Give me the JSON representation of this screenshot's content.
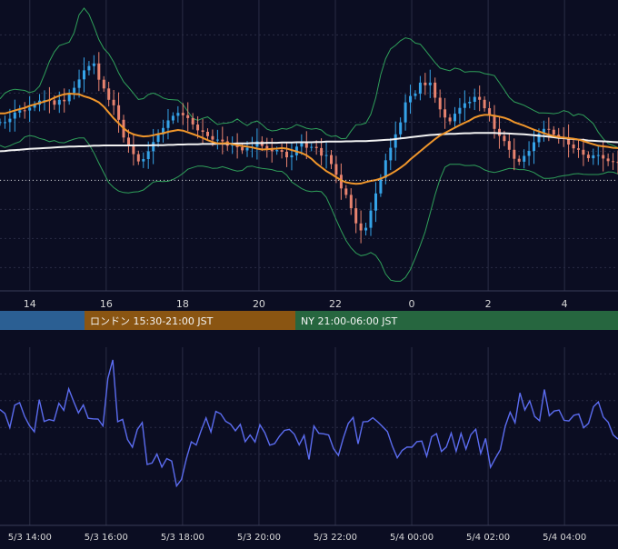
{
  "colors": {
    "background": "#0b0d22",
    "grid": "#2a2d45",
    "up": "#35a3e8",
    "down": "#e8836f",
    "bollinger": "#2fa05a",
    "ma_short": "#f0962b",
    "ma_long": "#f2f2f2",
    "oscillator": "#5b6cf0",
    "axis_text": "#d8d8d8",
    "session_tokyo": "#2b5f93",
    "session_london": "#8a5512",
    "session_ny": "#26663f"
  },
  "sessions": [
    {
      "label": "",
      "color": "#2b5f93"
    },
    {
      "label": "ロンドン 15:30-21:00 JST",
      "color": "#8a5512"
    },
    {
      "label": "NY 21:00-06:00 JST",
      "color": "#26663f"
    }
  ],
  "chart_data": [
    {
      "type": "candlestick",
      "x_tick_labels": [
        "14",
        "16",
        "18",
        "20",
        "22",
        "0",
        "2",
        "4"
      ],
      "x_ticks_hours": [
        14,
        16,
        18,
        20,
        22,
        24,
        26,
        28
      ],
      "x_range_hours": [
        13.22,
        29.4
      ],
      "y_range": [
        0,
        100
      ],
      "y_grid": [
        8,
        18,
        28,
        38,
        48,
        58,
        68,
        78,
        88
      ],
      "reference_level": 38,
      "series": [
        {
          "role": "price_close",
          "values": [
            58,
            58.0,
            59.2,
            61.3,
            62.1,
            62.0,
            63.0,
            64.0,
            65.4,
            65.6,
            65.5,
            64.0,
            65.7,
            65.2,
            68.1,
            69.8,
            72.7,
            75.8,
            77.3,
            78.2,
            72.6,
            69.6,
            65.7,
            63.8,
            58.8,
            52.7,
            50.3,
            47.0,
            44.5,
            45.3,
            48.0,
            51.2,
            53.8,
            56.0,
            58.6,
            60.2,
            61.2,
            60.4,
            59.4,
            57.2,
            55.2,
            54.7,
            53.2,
            52.0,
            52.0,
            51.4,
            49.9,
            50.3,
            49.4,
            48.3,
            49.2,
            49.6,
            51.4,
            49.8,
            48.6,
            48.0,
            48.4,
            47.8,
            45.9,
            46.6,
            49.6,
            51.0,
            49.2,
            49.5,
            49.1,
            46.5,
            46.7,
            43.6,
            39.9,
            35.2,
            33.0,
            28.4,
            23.2,
            20.8,
            21.7,
            27.6,
            33.5,
            38.9,
            44.9,
            49.2,
            53.8,
            57.9,
            64.8,
            67.0,
            67.8,
            71.6,
            70.7,
            71.6,
            66.4,
            62.4,
            59.6,
            58.3,
            60.9,
            62.9,
            64.5,
            65.0,
            66.7,
            65.7,
            62.8,
            60.5,
            55.7,
            53.3,
            51.5,
            48.5,
            45.4,
            44.4,
            46.4,
            48.1,
            51.1,
            54.1,
            55.7,
            55.4,
            53.7,
            52.9,
            52.8,
            50.3,
            49.0,
            48.5,
            46.8,
            45.6,
            46.6,
            46.7,
            45.5,
            44.6,
            44.4,
            44.0
          ]
        },
        {
          "role": "bollinger_upper",
          "values": [
            66,
            68.0,
            68.9,
            69.3,
            69.1,
            68.9,
            68.2,
            68.7,
            70.4,
            74.5,
            78.9,
            82.2,
            84.3,
            84.9,
            85.5,
            88.8,
            94.9,
            97.2,
            95.1,
            90.9,
            86.4,
            83.3,
            81.5,
            78.7,
            74.9,
            71.9,
            70.0,
            67.9,
            65.8,
            66.1,
            67.5,
            68.0,
            67.3,
            66.3,
            65.8,
            65.7,
            65.6,
            64.1,
            61.7,
            59.3,
            58.6,
            59.3,
            59.8,
            58.5,
            57.2,
            57.6,
            57.7,
            58.1,
            59.1,
            57.8,
            56.8,
            57.9,
            58.4,
            57.2,
            55.6,
            55.0,
            55.2,
            55.8,
            55.6,
            56.2,
            57.2,
            56.6,
            55.9,
            55.6,
            55.8,
            55.3,
            53.8,
            53.1,
            53.3,
            52.3,
            52.4,
            54.9,
            57.1,
            57.2,
            57.7,
            60.7,
            66.3,
            74.3,
            79.8,
            83.2,
            84.4,
            86.0,
            87.0,
            86.6,
            85.2,
            84.8,
            82.8,
            80.6,
            78.5,
            76.6,
            76.1,
            75.7,
            76.6,
            76.2,
            75.2,
            75.4,
            75.4,
            75.3,
            74.7,
            74.4,
            74.0,
            71.6,
            69.1,
            66.5,
            65.0,
            64.4,
            63.8,
            62.9,
            62.0,
            61.2,
            61.2,
            61.1,
            60.9,
            61.2,
            62.0,
            61.5,
            60.2,
            60.8,
            60.4,
            59.0,
            57.5,
            54.6,
            52.3,
            50.7,
            50.0,
            49.2,
            48.4
          ]
        },
        {
          "role": "bollinger_lower",
          "values": [
            50,
            49.3,
            49.9,
            50.7,
            51.3,
            52.9,
            53.4,
            53.1,
            52.4,
            52.0,
            51.3,
            51.7,
            51.0,
            50.9,
            51.6,
            52.2,
            52.6,
            52.6,
            50.4,
            47.4,
            43.9,
            40.6,
            37.2,
            35.5,
            34.3,
            33.8,
            33.7,
            34.0,
            34.1,
            34.7,
            36.0,
            37.4,
            37.7,
            37.6,
            37.7,
            38.3,
            39.2,
            40.4,
            41.8,
            42.4,
            42.9,
            42.9,
            42.6,
            42.1,
            42.2,
            42.7,
            42.2,
            41.6,
            41.2,
            41.4,
            42.7,
            42.9,
            42.4,
            42.1,
            41.9,
            41.7,
            41.2,
            41.1,
            39.8,
            37.4,
            36.3,
            35.2,
            34.4,
            34.1,
            34.3,
            34.1,
            32.2,
            28.4,
            24.5,
            20.7,
            17.3,
            14.8,
            13.0,
            12.1,
            12.4,
            13.2,
            12.2,
            9.7,
            5.8,
            3.7,
            3.3,
            3.3,
            4.6,
            7.3,
            11.3,
            15.6,
            20.3,
            26.7,
            33.0,
            38.5,
            42.5,
            43.5,
            43.5,
            43.5,
            43.1,
            43.1,
            43.2,
            42.6,
            41.6,
            41.0,
            40.7,
            41.1,
            41.6,
            42.1,
            42.0,
            41.7,
            41.7,
            41.3,
            40.7,
            39.6,
            38.7,
            38.7,
            38.8,
            39.3,
            39.6,
            39.8,
            40.2,
            40.3,
            40.1,
            40.0,
            40.0,
            40.0,
            40.3,
            40.9,
            40.8,
            40.2,
            40.4
          ]
        },
        {
          "role": "moving_average_short",
          "values": [
            61,
            61.0,
            61.5,
            62.0,
            62.5,
            62.9,
            63.6,
            64.1,
            64.6,
            65.1,
            65.6,
            66.4,
            67.1,
            67.6,
            67.8,
            67.7,
            67.6,
            66.9,
            66.4,
            65.7,
            64.8,
            63.3,
            61.3,
            59.3,
            57.6,
            55.9,
            54.6,
            53.8,
            53.4,
            53.1,
            53.2,
            53.5,
            53.9,
            54.2,
            54.7,
            55.0,
            55.3,
            55.1,
            54.5,
            53.9,
            53.3,
            52.6,
            51.8,
            51.2,
            50.7,
            50.7,
            50.8,
            50.4,
            50.1,
            49.8,
            49.6,
            49.3,
            48.9,
            48.6,
            48.7,
            48.8,
            48.9,
            49.1,
            48.9,
            48.4,
            47.9,
            47.4,
            46.6,
            45.4,
            43.8,
            42.5,
            41.2,
            40.2,
            39.1,
            38.0,
            37.3,
            37.0,
            36.8,
            36.9,
            37.4,
            37.8,
            38.1,
            38.6,
            39.3,
            40.2,
            41.2,
            42.3,
            43.6,
            45.2,
            46.6,
            48.0,
            49.4,
            50.8,
            52.2,
            53.4,
            54.3,
            55.2,
            56.1,
            57.0,
            57.8,
            58.6,
            59.6,
            60.2,
            60.5,
            60.5,
            60.2,
            59.9,
            59.5,
            58.9,
            58.0,
            57.4,
            56.8,
            56.1,
            55.4,
            54.8,
            54.2,
            53.7,
            53.2,
            52.9,
            52.7,
            52.5,
            52.3,
            52.0,
            51.5,
            50.9,
            50.4,
            49.9,
            49.7,
            49.5,
            49.2,
            49.1,
            48.5
          ]
        },
        {
          "role": "moving_average_long",
          "values": [
            48,
            48.1,
            48.3,
            48.4,
            48.5,
            48.7,
            48.8,
            48.9,
            49.0,
            49.1,
            49.2,
            49.3,
            49.4,
            49.5,
            49.6,
            49.6,
            49.7,
            49.7,
            49.8,
            49.9,
            49.9,
            50.0,
            50.0,
            50.0,
            50.0,
            50.0,
            50.0,
            50.0,
            50.0,
            50.0,
            50.0,
            50.1,
            50.1,
            50.1,
            50.2,
            50.2,
            50.3,
            50.3,
            50.4,
            50.4,
            50.4,
            50.5,
            50.5,
            50.5,
            50.6,
            50.6,
            50.6,
            50.6,
            50.7,
            50.7,
            50.7,
            50.8,
            50.8,
            50.8,
            50.9,
            50.9,
            50.9,
            51.0,
            51.0,
            51.0,
            51.1,
            51.1,
            51.1,
            51.1,
            51.2,
            51.2,
            51.3,
            51.3,
            51.3,
            51.3,
            51.4,
            51.4,
            51.5,
            51.5,
            51.5,
            51.6,
            51.7,
            51.8,
            51.9,
            52.0,
            52.2,
            52.4,
            52.6,
            52.8,
            53.0,
            53.2,
            53.4,
            53.6,
            53.7,
            53.8,
            53.9,
            54.0,
            54.0,
            54.1,
            54.2,
            54.2,
            54.3,
            54.3,
            54.3,
            54.3,
            54.3,
            54.2,
            54.2,
            54.1,
            54.0,
            53.9,
            53.8,
            53.7,
            53.5,
            53.3,
            53.2,
            53.0,
            52.8,
            52.6,
            52.5,
            52.3,
            52.2,
            52.0,
            51.9,
            51.7,
            51.6,
            51.5,
            51.4,
            51.3,
            51.2,
            51.1,
            51.0
          ]
        }
      ]
    },
    {
      "type": "line",
      "x_tick_labels": [
        "5/3 14:00",
        "5/3 16:00",
        "5/3 18:00",
        "5/3 20:00",
        "5/3 22:00",
        "5/4 00:00",
        "5/4 02:00",
        "5/4 04:00"
      ],
      "x_ticks_hours": [
        14,
        16,
        18,
        20,
        22,
        24,
        26,
        28
      ],
      "x_range_hours": [
        13.22,
        29.4
      ],
      "y_range": [
        0,
        100
      ],
      "y_grid": [
        25,
        40,
        55,
        70,
        85
      ],
      "series": [
        {
          "role": "oscillator",
          "values": [
            65,
            62.8,
            54.9,
            67.5,
            68.9,
            61.3,
            56.0,
            52.5,
            70.6,
            58.3,
            59.4,
            58.7,
            68.5,
            64.6,
            76.7,
            69.6,
            63.1,
            67.6,
            60.1,
            59.8,
            59.7,
            55.8,
            82.5,
            92.9,
            58.2,
            59.5,
            48.2,
            43.9,
            53.8,
            57.7,
            34.2,
            35.0,
            40.0,
            32.7,
            37.5,
            36.1,
            22.1,
            25.8,
            37.4,
            46.9,
            45.1,
            53.2,
            60.3,
            52.4,
            64.0,
            62.6,
            58.4,
            56.8,
            53.1,
            56.7,
            47.0,
            50.7,
            46.8,
            56.5,
            52.0,
            45.0,
            45.9,
            50.1,
            53.3,
            53.9,
            51.2,
            45.2,
            50.5,
            37.0,
            55.8,
            51.7,
            51.4,
            50.7,
            43.1,
            39.3,
            49.1,
            57.2,
            60.6,
            45.7,
            58.1,
            58.3,
            60.4,
            58.1,
            55.4,
            52.6,
            44.5,
            37.9,
            42.1,
            44.0,
            43.9,
            47.0,
            47.3,
            38.8,
            49.7,
            51.5,
            41.5,
            44.0,
            51.8,
            41.6,
            51.6,
            42.8,
            50.9,
            54.0,
            40.3,
            48.8,
            32.6,
            37.7,
            42.5,
            55.6,
            63.5,
            57.6,
            74.4,
            64.8,
            69.9,
            61.1,
            58.7,
            76.3,
            61.6,
            64.2,
            64.7,
            59.0,
            58.6,
            61.8,
            62.5,
            54.8,
            57.3,
            66.6,
            69.3,
            60.8,
            57.9,
            50.8,
            48.4
          ]
        }
      ]
    }
  ]
}
